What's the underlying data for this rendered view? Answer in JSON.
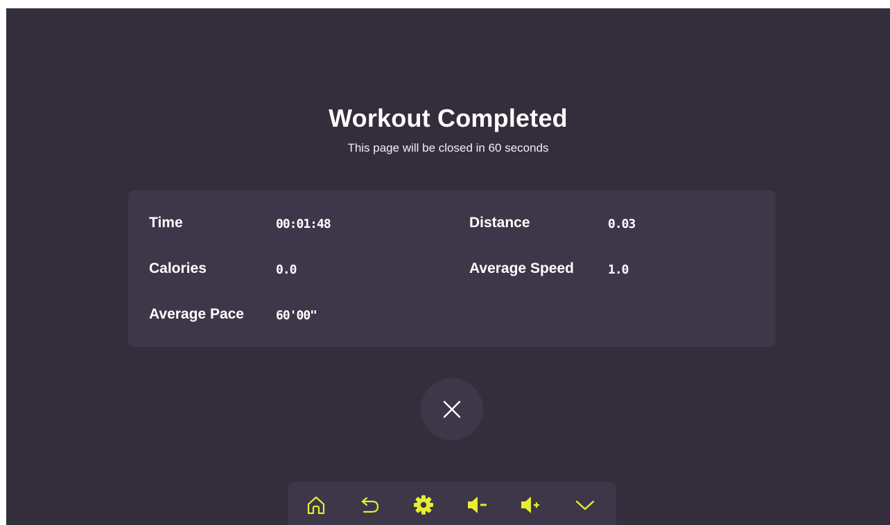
{
  "header": {
    "title": "Workout Completed",
    "subtitle": "This page will be closed in 60 seconds"
  },
  "stats": [
    {
      "label": "Time",
      "value": "00:01:48"
    },
    {
      "label": "Distance",
      "value": "0.03"
    },
    {
      "label": "Calories",
      "value": "0.0"
    },
    {
      "label": "Average Speed",
      "value": "1.0"
    },
    {
      "label": "Average Pace",
      "value": "60'00\""
    }
  ],
  "close_button": {
    "icon": "close-icon"
  },
  "toolbar": {
    "icons": [
      "home-icon",
      "back-icon",
      "gear-icon",
      "volume-down-icon",
      "volume-up-icon",
      "chevron-down-icon"
    ]
  },
  "colors": {
    "background": "#342d3b",
    "card": "#3d3749",
    "accent": "#e6ee2f",
    "text": "#ffffff"
  }
}
